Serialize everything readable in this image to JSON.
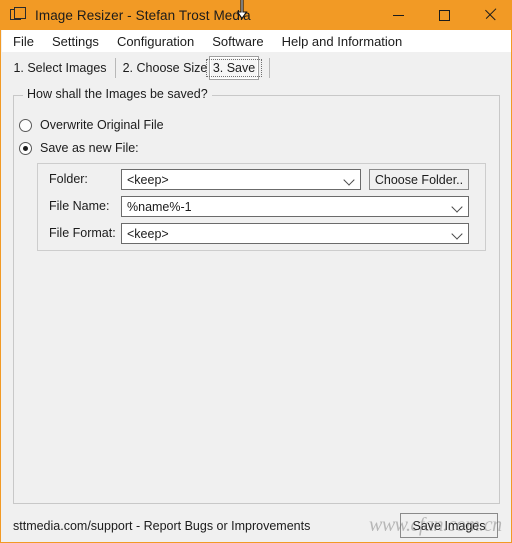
{
  "window": {
    "title": "Image Resizer - Stefan Trost Media",
    "icon": "cascade-windows-icon",
    "accent_color": "#F29A25",
    "controls": [
      {
        "name": "minimize",
        "glyph": "—"
      },
      {
        "name": "maximize",
        "glyph": "□"
      },
      {
        "name": "close",
        "glyph": "✕"
      }
    ]
  },
  "menubar": {
    "items": [
      {
        "label": "File"
      },
      {
        "label": "Settings"
      },
      {
        "label": "Configuration"
      },
      {
        "label": "Software"
      },
      {
        "label": "Help and Information"
      }
    ]
  },
  "tabs": [
    {
      "label": "1. Select Images",
      "active": false
    },
    {
      "label": "2. Choose Size",
      "active": false
    },
    {
      "label": "3. Save",
      "active": true
    }
  ],
  "main": {
    "group_legend": "How shall the Images be saved?",
    "save_mode": {
      "options": [
        {
          "label": "Overwrite Original File",
          "selected": false
        },
        {
          "label": "Save as new File:",
          "selected": true
        }
      ]
    },
    "fields": [
      {
        "label": "Folder:",
        "value": "<keep>",
        "control": "combobox"
      },
      {
        "label": "File Name:",
        "value": "%name%-1",
        "control": "combobox"
      },
      {
        "label": "File Format:",
        "value": "<keep>",
        "control": "combobox"
      }
    ],
    "choose_folder_button": "Choose Folder.."
  },
  "statusbar": {
    "support_text": "sttmedia.com/support - Report Bugs or Improvements",
    "save_button": "Save Images"
  },
  "overlay": {
    "watermark": "www.cfan.com.cn"
  }
}
